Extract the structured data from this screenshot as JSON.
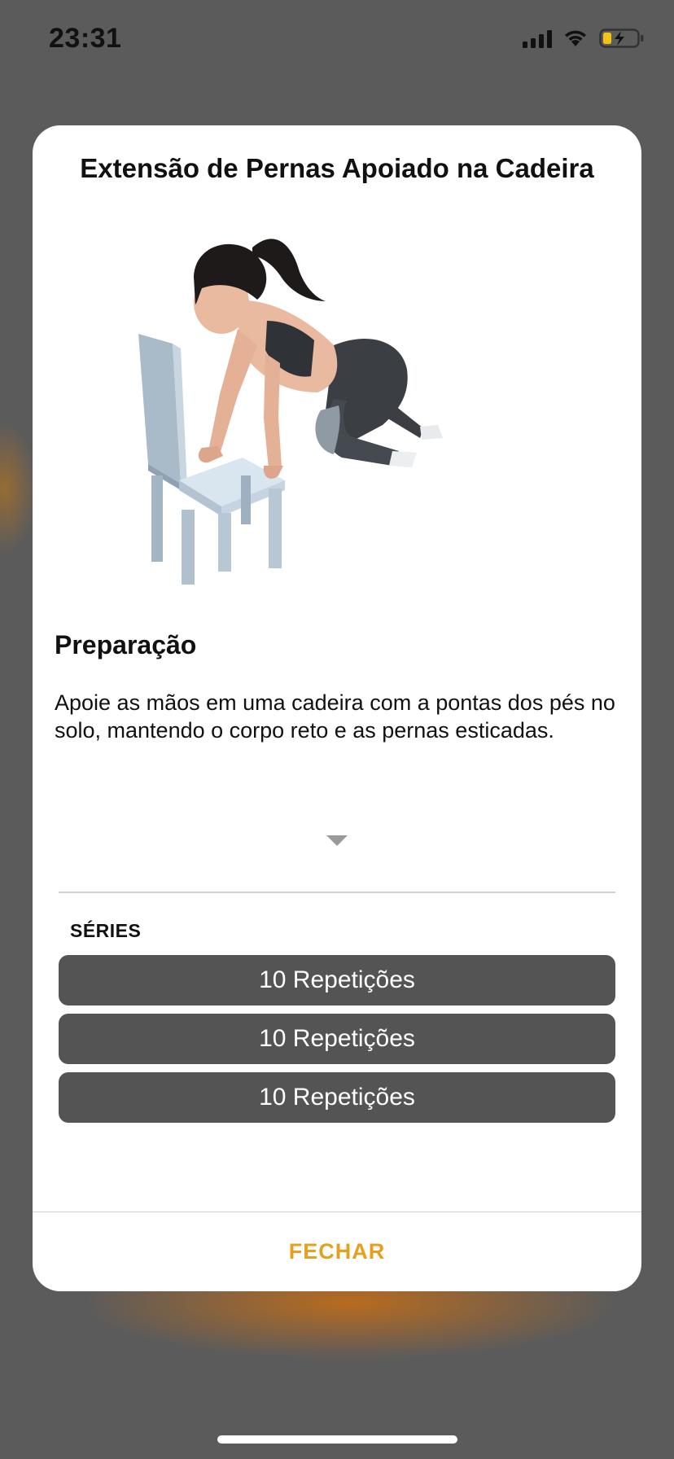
{
  "status_bar": {
    "time": "23:31",
    "icons": [
      "cellular-signal-icon",
      "wifi-icon",
      "battery-charging-icon"
    ]
  },
  "modal": {
    "title": "Extensão de Pernas Apoiado na Cadeira",
    "illustration": "exercise-illustration",
    "section_heading": "Preparação",
    "description": "Apoie as mãos em uma cadeira com a pontas dos pés no solo, mantendo o corpo reto e as pernas esticadas.",
    "expand_icon": "chevron-down-icon",
    "series_label": "SÉRIES",
    "series": [
      {
        "label": "10 Repetições"
      },
      {
        "label": "10 Repetições"
      },
      {
        "label": "10 Repetições"
      }
    ],
    "close_label": "FECHAR"
  },
  "colors": {
    "accent": "#e6a020",
    "series_button": "#545454",
    "backdrop": "#5b5b5b",
    "battery_charging": "#f2c40f"
  }
}
